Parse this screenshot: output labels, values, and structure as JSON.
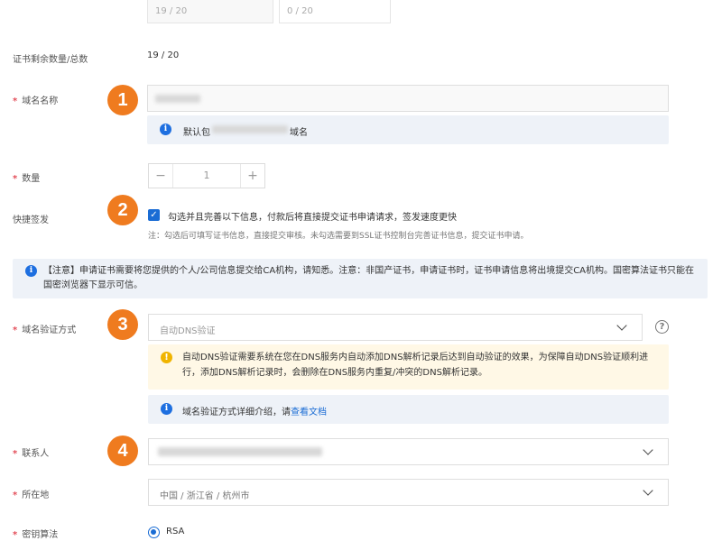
{
  "top_fields": {
    "left_value": "19 / 20",
    "right_value": "0 / 20"
  },
  "remaining": {
    "label": "证书剩余数量/总数",
    "value": "19 / 20"
  },
  "domain": {
    "label": "域名名称",
    "step": "1",
    "info_prefix": "默认包",
    "info_suffix": "域名"
  },
  "quantity": {
    "label": "数量",
    "minus": "−",
    "value": "1",
    "plus": "+"
  },
  "quick_issue": {
    "label": "快捷签发",
    "step": "2",
    "checkbox_text": "勾选并且完善以下信息，付款后将直接提交证书申请请求，签发速度更快",
    "note": "注：勾选后可填写证书信息，直接提交审核。未勾选需要到SSL证书控制台完善证书信息，提交证书申请。"
  },
  "notice": {
    "text": "【注意】申请证书需要将您提供的个人/公司信息提交给CA机构，请知悉。注意：非国产证书，申请证书时，证书申请信息将出境提交CA机构。国密算法证书只能在国密浏览器下显示可信。"
  },
  "verify": {
    "label": "域名验证方式",
    "step": "3",
    "selected": "自动DNS验证",
    "help": "?",
    "warning": "自动DNS验证需要系统在您在DNS服务内自动添加DNS解析记录后达到自动验证的效果，为保障自动DNS验证顺利进行，添加DNS解析记录时，会删除在DNS服务内重复/冲突的DNS解析记录。",
    "doc_prefix": "域名验证方式详细介绍，请",
    "doc_link": "查看文档"
  },
  "contact": {
    "label": "联系人",
    "step": "4"
  },
  "location": {
    "label": "所在地",
    "value": "中国 / 浙江省 / 杭州市"
  },
  "algorithm": {
    "label": "密钥算法",
    "option": "RSA"
  },
  "colors": {
    "badge": "#ef7b1f",
    "primary": "#1a6cd4",
    "info_bg": "#eef2f8",
    "warn_bg": "#fff8e6",
    "required": "#e34d59"
  }
}
